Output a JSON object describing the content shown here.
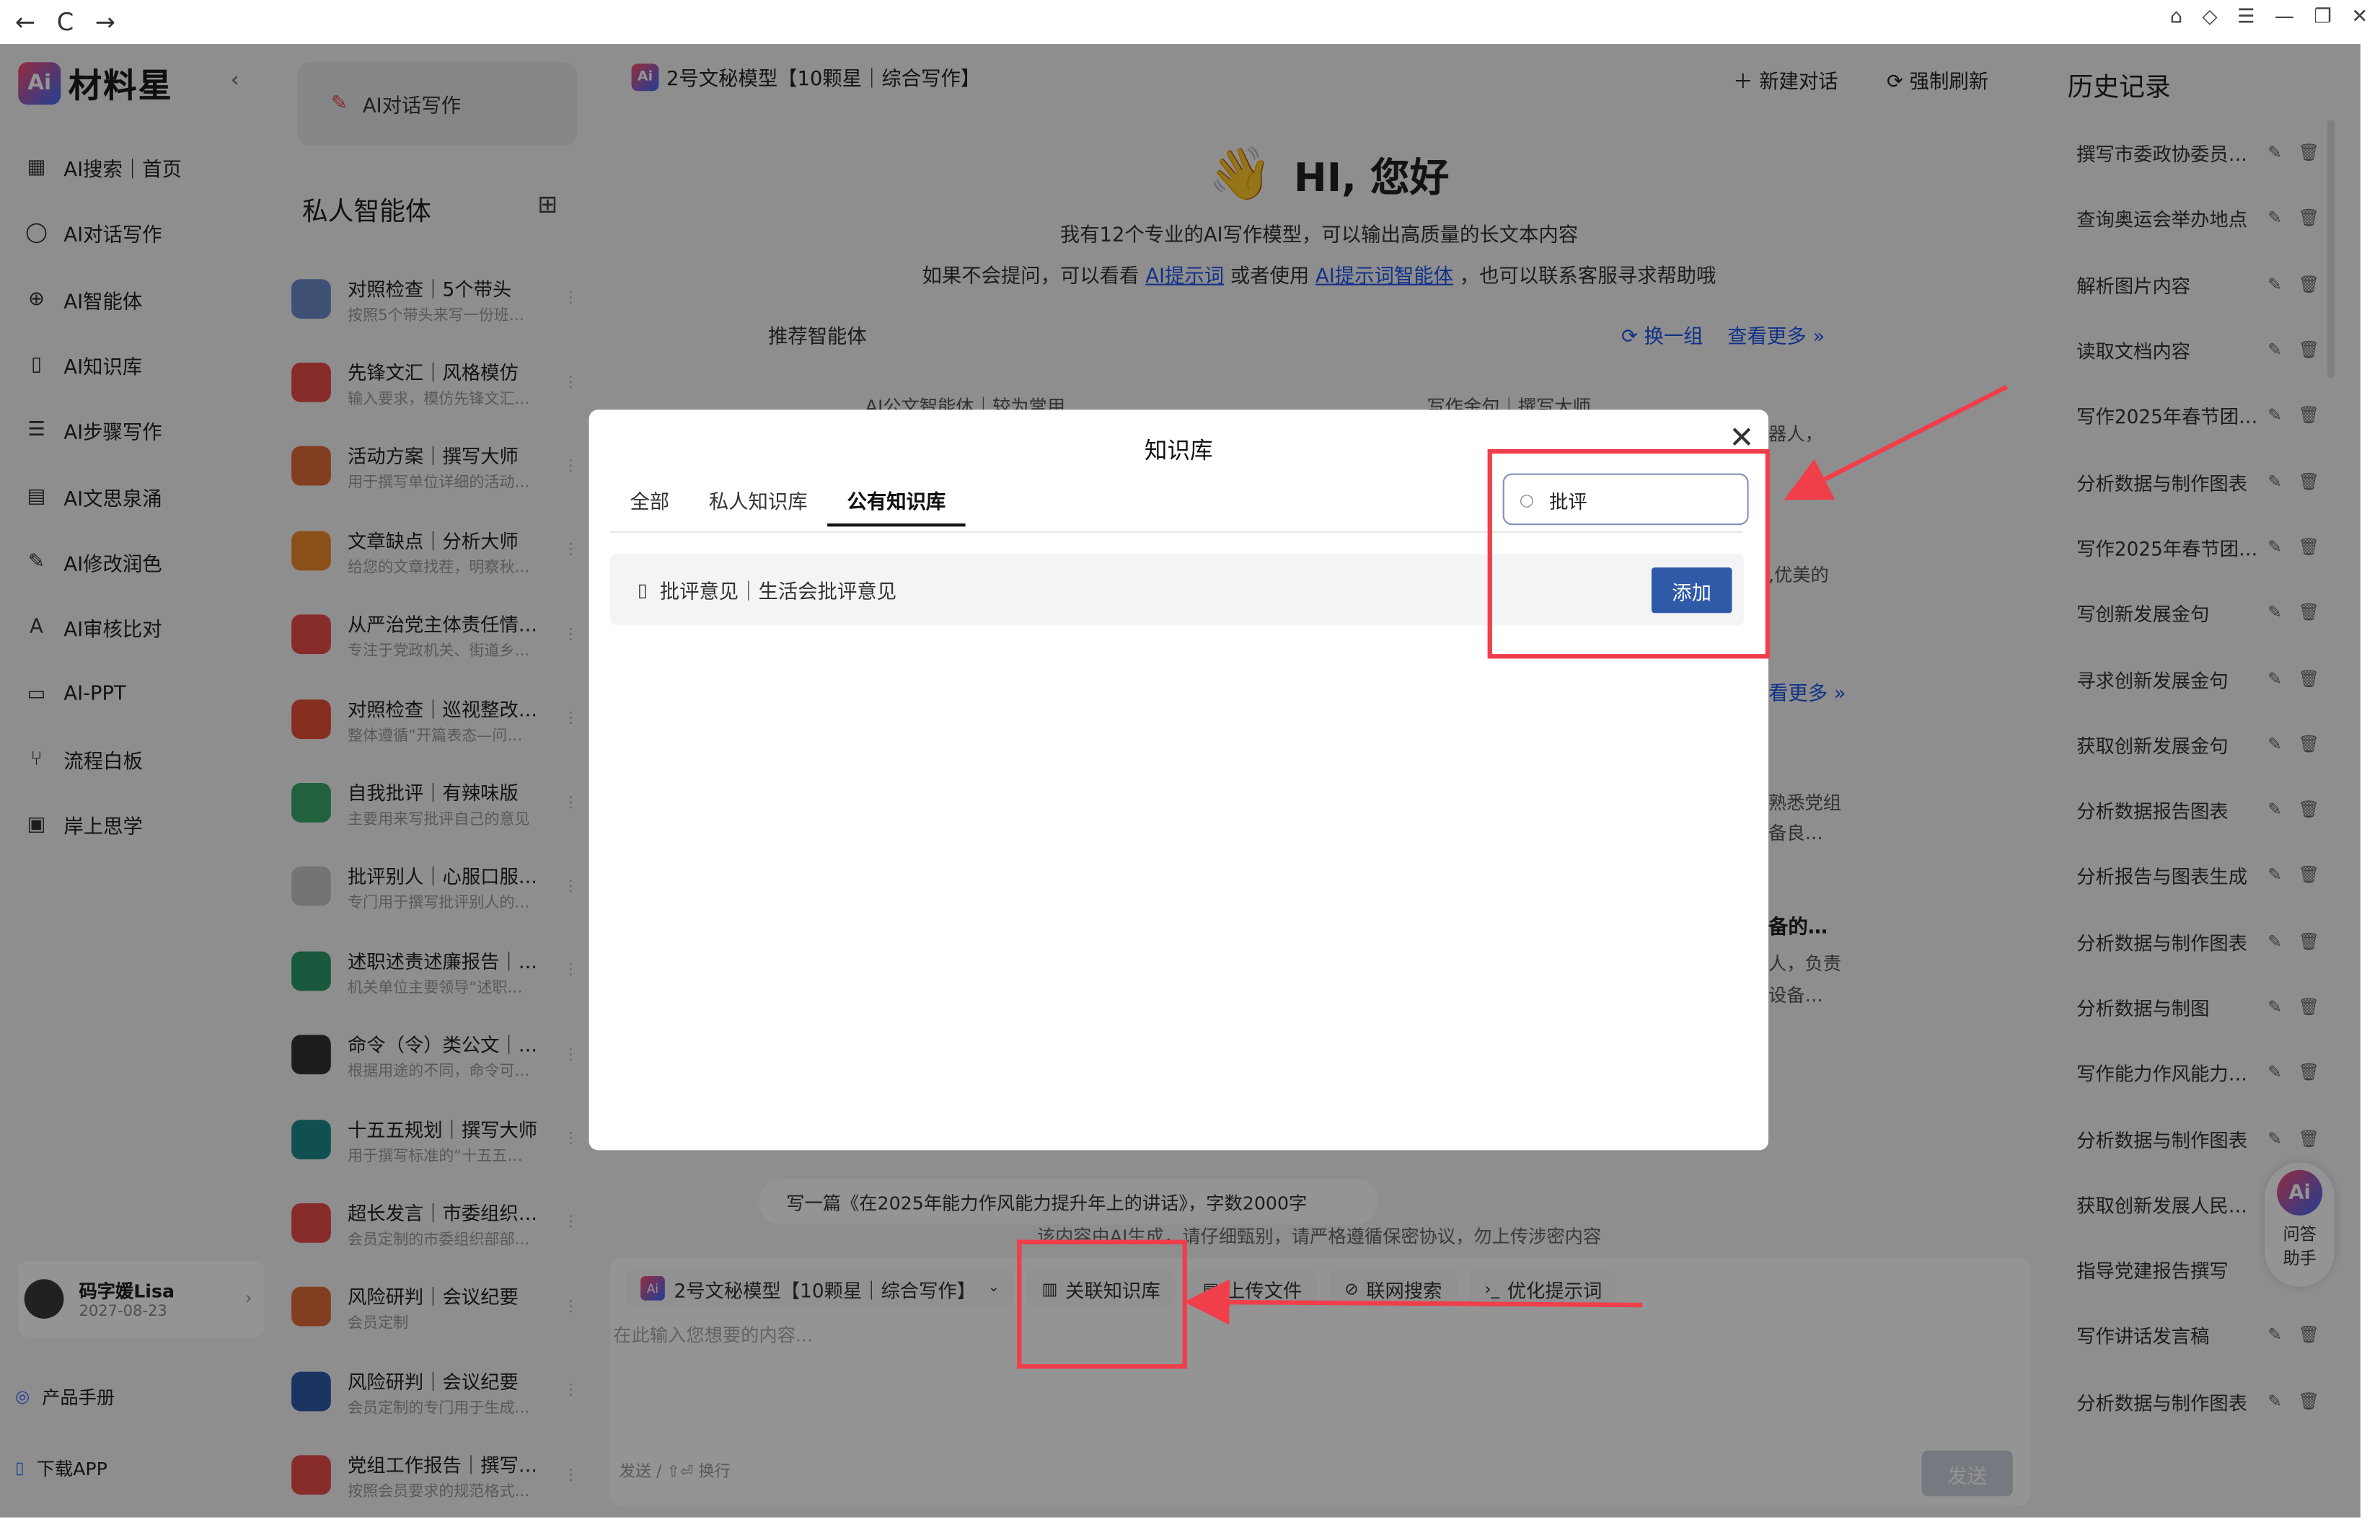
{
  "browser": {
    "back": "←",
    "reload": "C",
    "forward": "→"
  },
  "app": {
    "logo": "材料星",
    "logo_mark": "Ai",
    "menu": [
      {
        "icon": "grid-icon",
        "glyph": "▦",
        "label": "AI搜索｜首页"
      },
      {
        "icon": "chat-icon",
        "glyph": "◯",
        "label": "AI对话写作"
      },
      {
        "icon": "agent-icon",
        "glyph": "⊕",
        "label": "AI智能体"
      },
      {
        "icon": "book-icon",
        "glyph": "▯",
        "label": "AI知识库"
      },
      {
        "icon": "list-icon",
        "glyph": "☰",
        "label": "AI步骤写作"
      },
      {
        "icon": "keyboard-icon",
        "glyph": "▤",
        "label": "AI文思泉涌"
      },
      {
        "icon": "pen-icon",
        "glyph": "✎",
        "label": "AI修改润色"
      },
      {
        "icon": "review-icon",
        "glyph": "A",
        "label": "AI审核比对"
      },
      {
        "icon": "ppt-icon",
        "glyph": "▭",
        "label": "AI-PPT"
      },
      {
        "icon": "flow-icon",
        "glyph": "⑂",
        "label": "流程白板"
      },
      {
        "icon": "screen-icon",
        "glyph": "▣",
        "label": "岸上思学"
      }
    ],
    "user": {
      "name": "码字媛Lisa",
      "date": "2027-08-23"
    },
    "footer": {
      "manual": "产品手册",
      "download": "下载APP"
    }
  },
  "agents": {
    "chat_button": "AI对话写作",
    "heading": "私人智能体",
    "items": [
      {
        "title": "对照检查｜5个带头",
        "sub": "按照5个带头来写一份班…",
        "color": "#6c8ac9"
      },
      {
        "title": "先锋文汇｜风格模仿",
        "sub": "输入要求，模仿先锋文汇…",
        "color": "#e84a4a"
      },
      {
        "title": "活动方案｜撰写大师",
        "sub": "用于撰写单位详细的活动…",
        "color": "#e06b3a"
      },
      {
        "title": "文章缺点｜分析大师",
        "sub": "给您的文章找茬，明察秋…",
        "color": "#f08a2a"
      },
      {
        "title": "从严治党主体责任情…",
        "sub": "专注于党政机关、街道乡…",
        "color": "#e84a4a"
      },
      {
        "title": "对照检查｜巡视整改…",
        "sub": "整体遵循“开篇表态—问…",
        "color": "#e8503a"
      },
      {
        "title": "自我批评｜有辣味版",
        "sub": "主要用来写批评自己的意见",
        "color": "#3aa86b"
      },
      {
        "title": "批评别人｜心服口服…",
        "sub": "专门用于撰写批评别人的…",
        "color": "#c9c9c9"
      },
      {
        "title": "述职述责述廉报告｜…",
        "sub": "机关单位主要领导“述职…",
        "color": "#2b9a6a"
      },
      {
        "title": "命令（令）类公文｜…",
        "sub": "根据用途的不同，命令可…",
        "color": "#333333"
      },
      {
        "title": "十五五规划｜撰写大师",
        "sub": "用于撰写标准的“十五五…",
        "color": "#1e8a8a"
      },
      {
        "title": "超长发言｜市委组织…",
        "sub": "会员定制的市委组织部部…",
        "color": "#e84a4a"
      },
      {
        "title": "风险研判｜会议纪要",
        "sub": "会员定制",
        "color": "#e06b3a"
      },
      {
        "title": "风险研判｜会议纪要",
        "sub": "会员定制的专门用于生成…",
        "color": "#2f5aa8"
      },
      {
        "title": "党组工作报告｜撰写…",
        "sub": "按照会员要求的规范格式…",
        "color": "#e84a4a"
      }
    ]
  },
  "main": {
    "model": "2号文秘模型【10颗星｜综合写作】",
    "model_mark": "Ai",
    "new_chat": "新建对话",
    "refresh": "强制刷新",
    "greeting": "HI, 您好",
    "intro1": "我有12个专业的AI写作模型，可以输出高质量的长文本内容",
    "intro2_a": "如果不会提问，可以看看",
    "intro2_link1": "AI提示词",
    "intro2_b": "或者使用",
    "intro2_link2": "AI提示词智能体",
    "intro2_c": "，也可以联系客服寻求帮助哦",
    "recommend": "推荐智能体",
    "swap": "换一组",
    "more": "查看更多 »",
    "card_frag1": "AI公文智能体｜较为常用",
    "card_frag2": "写作金句｜撰写大师",
    "frag_robot": "器人，",
    "frag_excellent": ",优美的",
    "frag_more2": "看更多 »",
    "frag_party": "熟悉党组",
    "frag_good": "备良…",
    "frag_prepared": "备的…",
    "frag_resp": "人，负责",
    "frag_equip": "设备…",
    "suggestion": "写一篇《在2025年能力作风能力提升年上的讲话》，字数2000字",
    "disclaimer": "该内容由AI生成，请仔细甄别，请严格遵循保密协议，勿上传涉密内容",
    "tool_kb": "关联知识库",
    "tool_upload": "上传文件",
    "tool_web": "联网搜索",
    "tool_opt": "优化提示词",
    "placeholder": "在此输入您想要的内容...",
    "hint": "发送 / ⇧⏎ 换行",
    "send": "发送"
  },
  "history": {
    "title": "历史记录",
    "items": [
      "撰写市委政协委员…",
      "查询奥运会举办地点",
      "解析图片内容",
      "读取文档内容",
      "写作2025年春节团…",
      "分析数据与制作图表",
      "写作2025年春节团…",
      "写创新发展金句",
      "寻求创新发展金句",
      "获取创新发展金句",
      "分析数据报告图表",
      "分析报告与图表生成",
      "分析数据与制作图表",
      "分析数据与制图",
      "写作能力作风能力…",
      "分析数据与制作图表",
      "获取创新发展人民…",
      "指导党建报告撰写",
      "写作讲话发言稿",
      "分析数据与制作图表"
    ],
    "assistant_line1": "问答",
    "assistant_line2": "助手"
  },
  "modal": {
    "title": "知识库",
    "tabs": [
      "全部",
      "私人知识库",
      "公有知识库"
    ],
    "active_tab": 2,
    "search_value": "批评",
    "result": "批评意见｜生活会批评意见",
    "add": "添加"
  },
  "colors": {
    "accent": "#2f5aa8",
    "annotation": "#f03e4a",
    "link": "#2156e8"
  }
}
